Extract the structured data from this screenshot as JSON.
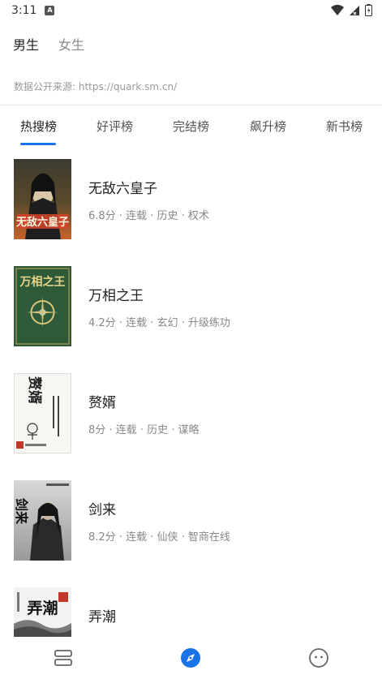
{
  "status_bar": {
    "time": "3:11",
    "notification_letter": "A"
  },
  "gender_tabs": [
    {
      "label": "男生",
      "active": true
    },
    {
      "label": "女生",
      "active": false
    }
  ],
  "source_text": "数据公开来源: https://quark.sm.cn/",
  "rank_tabs": [
    {
      "label": "热搜榜",
      "active": true
    },
    {
      "label": "好评榜",
      "active": false
    },
    {
      "label": "完结榜",
      "active": false
    },
    {
      "label": "飙升榜",
      "active": false
    },
    {
      "label": "新书榜",
      "active": false
    }
  ],
  "books": [
    {
      "title": "无敌六皇子",
      "meta": "6.8分 · 连载 · 历史 · 权术",
      "cover_text": "无敌六皇子"
    },
    {
      "title": "万相之王",
      "meta": "4.2分 · 连载 · 玄幻 · 升级练功",
      "cover_text": "万相之王"
    },
    {
      "title": "赘婿",
      "meta": "8分 · 连载 · 历史 · 谋略",
      "cover_text": "赘婿"
    },
    {
      "title": "剑来",
      "meta": "8.2分 · 连载 · 仙侠 · 智商在线",
      "cover_text": "剑来"
    },
    {
      "title": "弄潮",
      "meta": "",
      "cover_text": "弄潮"
    }
  ],
  "colors": {
    "accent": "#1a73e8"
  },
  "bottom_nav": [
    {
      "icon": "bookshelf-icon",
      "active": false
    },
    {
      "icon": "compass-icon",
      "active": true
    },
    {
      "icon": "smiley-face-icon",
      "active": false
    }
  ]
}
